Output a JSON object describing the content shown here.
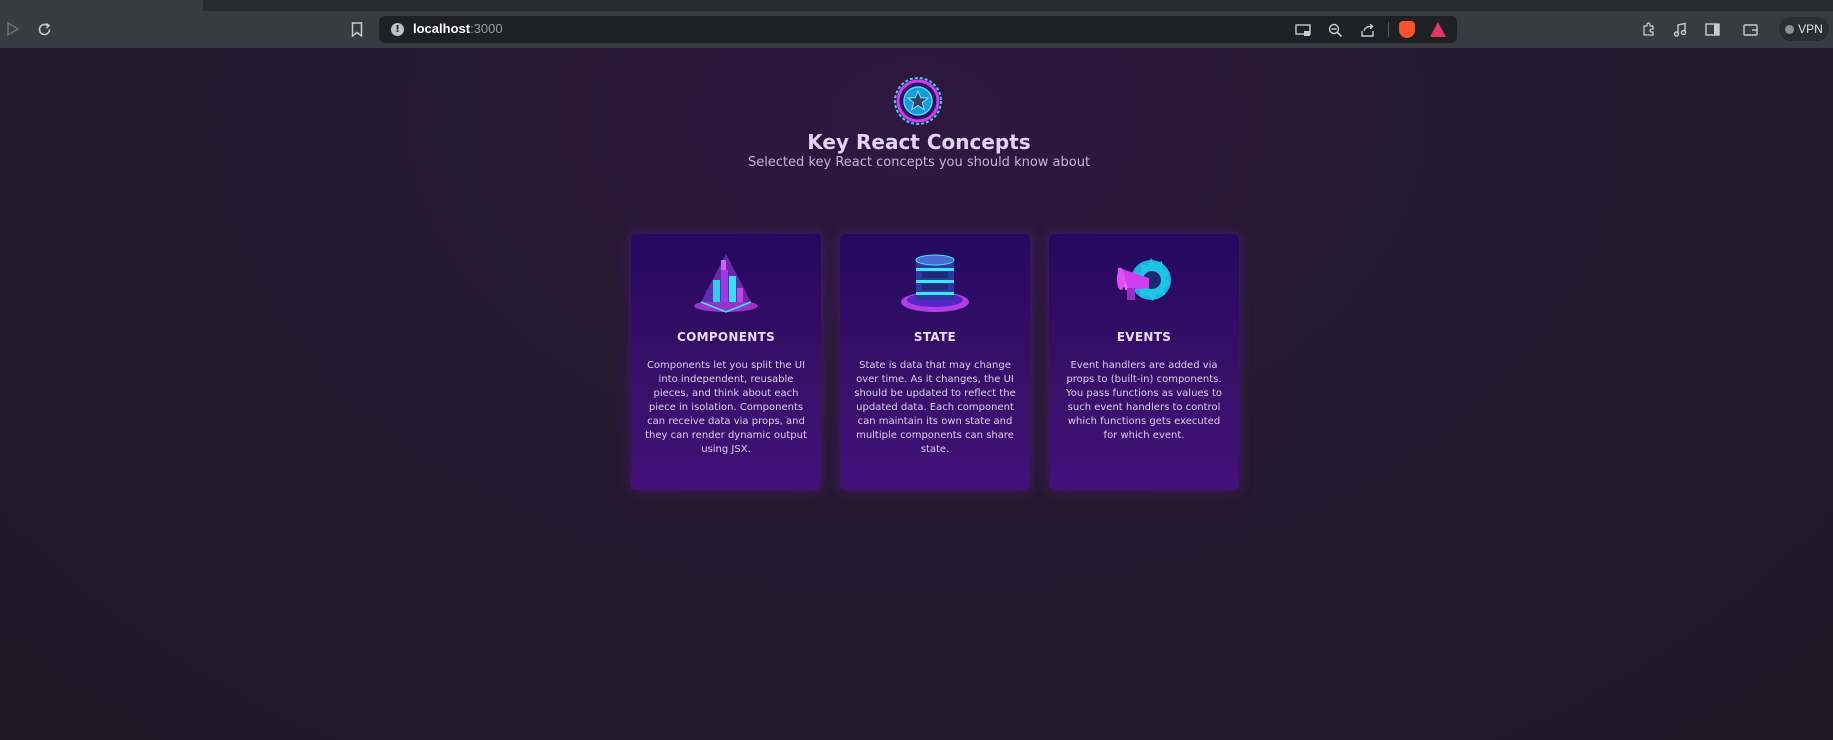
{
  "browser": {
    "tab_text": "",
    "tab2_text": "",
    "url_host": "localhost",
    "url_port": ":3000",
    "vpn_label": "VPN"
  },
  "header": {
    "title": "Key React Concepts",
    "subtitle": "Selected key React concepts you should know about"
  },
  "concepts": [
    {
      "title": "COMPONENTS",
      "icon": "components-icon",
      "description": "Components let you split the UI into independent, reusable pieces, and think about each piece in isolation. Components can receive data via props, and they can render dynamic output using JSX."
    },
    {
      "title": "STATE",
      "icon": "state-icon",
      "description": "State is data that may change over time. As it changes, the UI should be updated to reflect the updated data. Each component can maintain its own state and multiple components can share state."
    },
    {
      "title": "EVENTS",
      "icon": "events-icon",
      "description": "Event handlers are added via props to (built-in) components. You pass functions as values to such event handlers to control which functions gets executed for which event."
    }
  ],
  "colors": {
    "background": "#221b2b",
    "card_top": "#250860",
    "card_bottom": "#42107a",
    "accent_cyan": "#1ee6f0",
    "accent_magenta": "#d23cf0"
  }
}
